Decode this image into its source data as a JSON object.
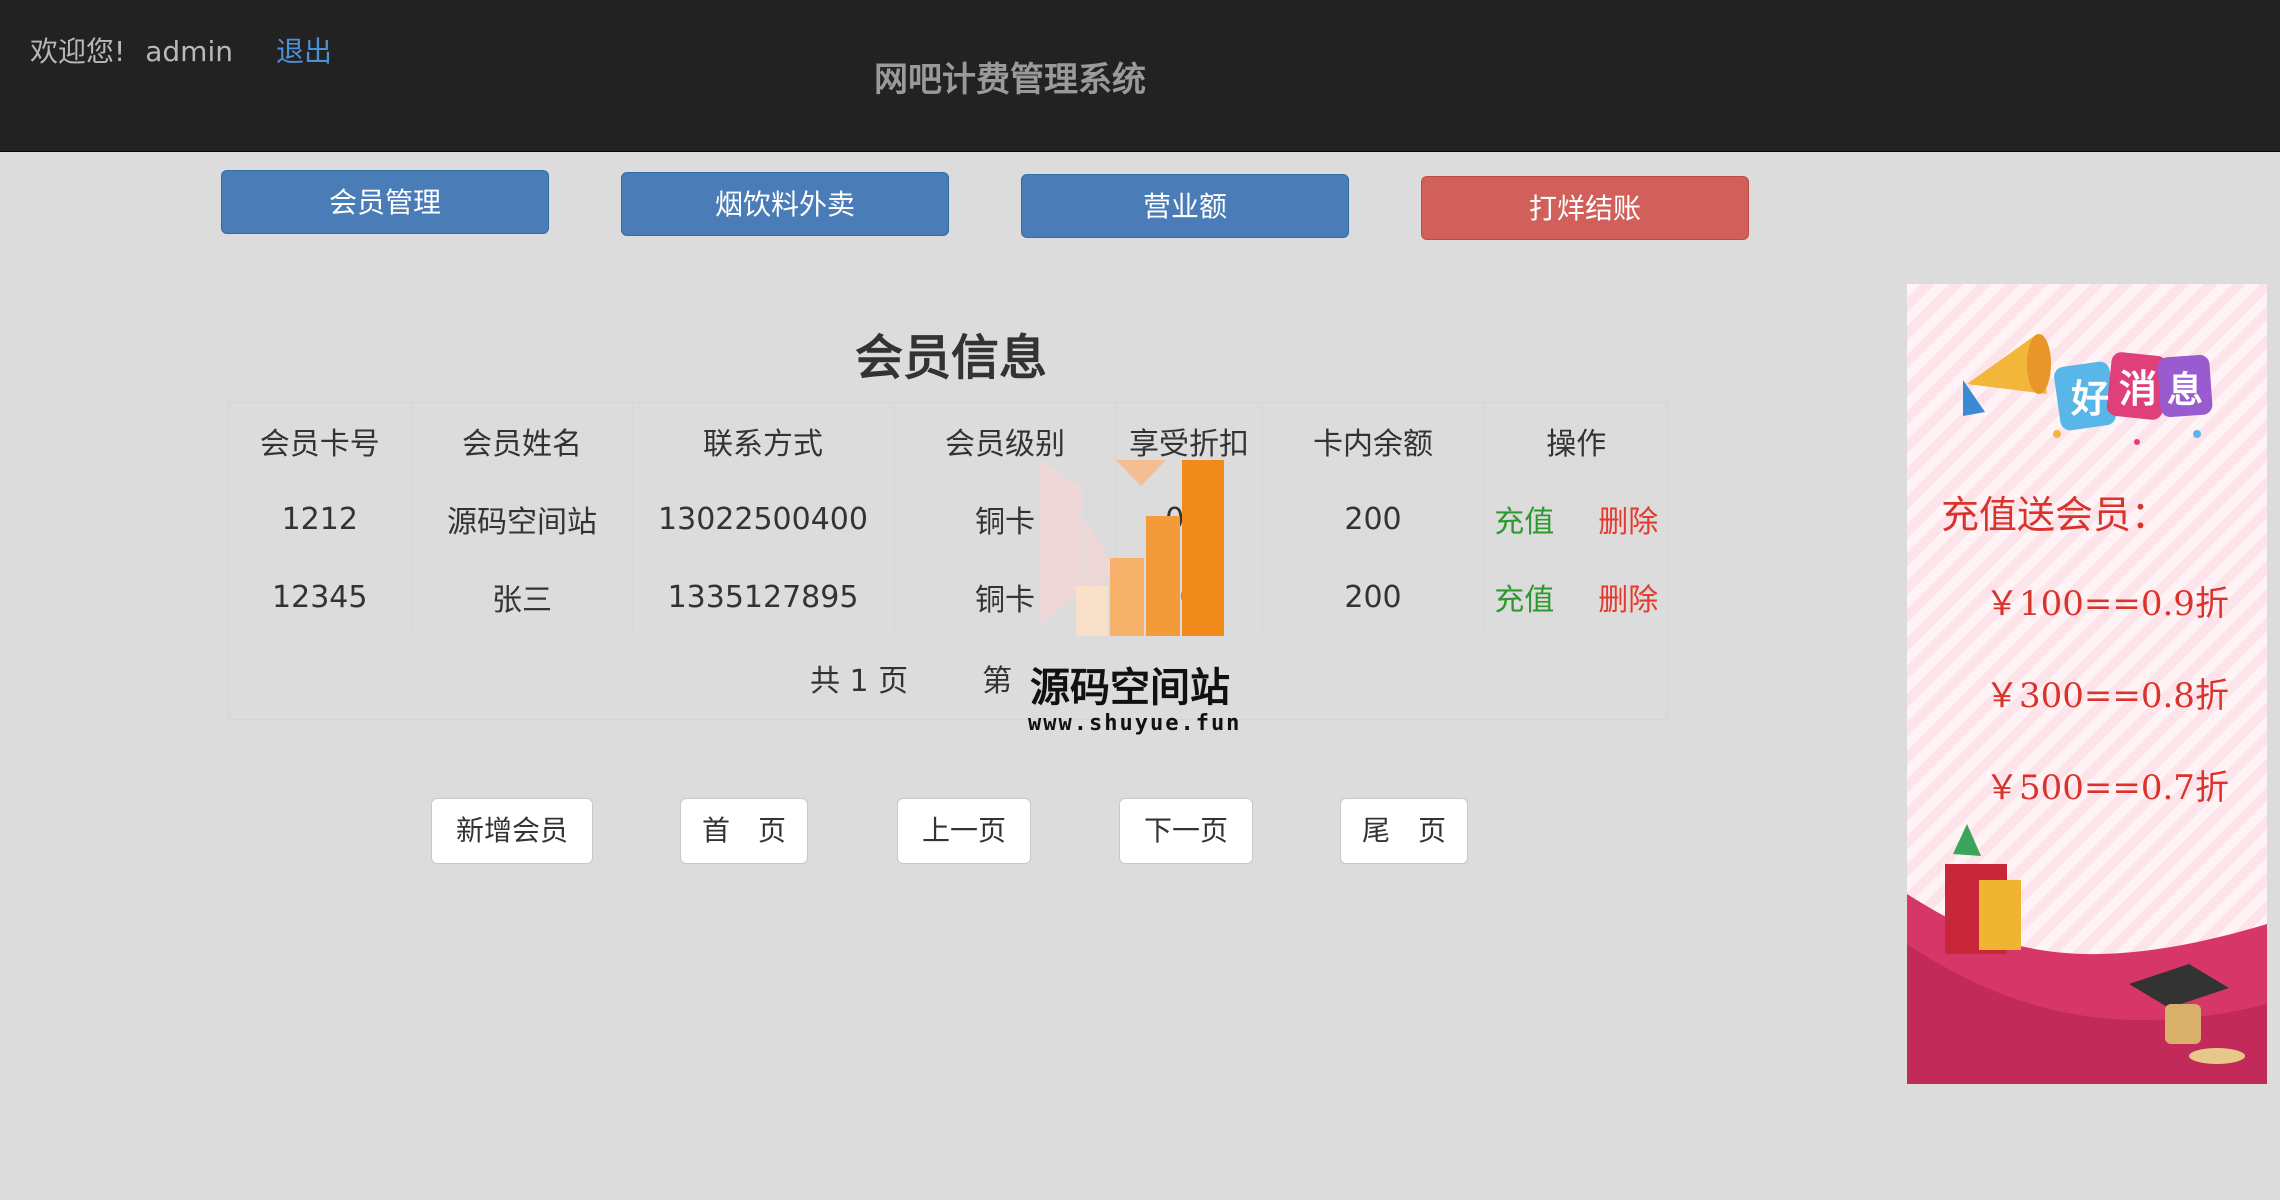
{
  "header": {
    "welcome": "欢迎您!",
    "username": "admin",
    "logout": "退出",
    "app_title": "网吧计费管理系统"
  },
  "nav": {
    "members": "会员管理",
    "snacks": "烟饮料外卖",
    "revenue": "营业额",
    "close": "打烊结账"
  },
  "section_title": "会员信息",
  "table": {
    "headers": [
      "会员卡号",
      "会员姓名",
      "联系方式",
      "会员级别",
      "享受折扣",
      "卡内余额",
      "操作"
    ],
    "rows": [
      {
        "card_no": "1212",
        "name": "源码空间站",
        "phone": "13022500400",
        "level": "铜卡",
        "discount": "0.9",
        "balance": "200",
        "charge": "充值",
        "delete": "删除"
      },
      {
        "card_no": "12345",
        "name": "张三",
        "phone": "1335127895",
        "level": "铜卡",
        "discount": "0",
        "balance": "200",
        "charge": "充值",
        "delete": "删除"
      }
    ]
  },
  "pager_info": {
    "total": "共 1 页",
    "current": "第"
  },
  "watermark": {
    "text": "源码空间站",
    "url": "www.shuyue.fun"
  },
  "pager": {
    "add": "新增会员",
    "first": "首　页",
    "prev": "上一页",
    "next": "下一页",
    "last": "尾　页"
  },
  "banner": {
    "headline": "充值送会员：",
    "tier1": "￥100==0.9折",
    "tier2": "￥300==0.8折",
    "tier3": "￥500==0.7折"
  },
  "colors": {
    "topbar": "#222222",
    "primary": "#4a7db8",
    "danger": "#d1605a",
    "charge": "#2e9a2e",
    "delete": "#e53b2c"
  }
}
